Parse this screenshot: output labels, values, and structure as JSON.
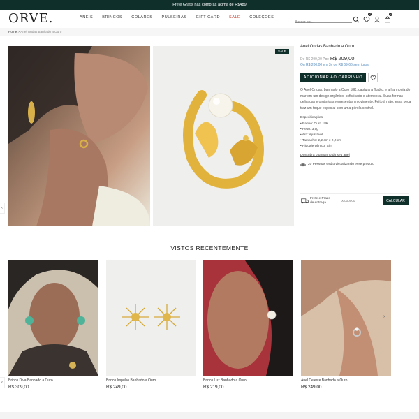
{
  "topbar": {
    "text": "Frete Grátis nas compras acima de R$489"
  },
  "header": {
    "logo": "ORVE.",
    "nav": [
      {
        "label": "ANÉIS",
        "sale": false
      },
      {
        "label": "BRINCOS",
        "sale": false
      },
      {
        "label": "COLARES",
        "sale": false
      },
      {
        "label": "PULSEIRAS",
        "sale": false
      },
      {
        "label": "GIFT CARD",
        "sale": false
      },
      {
        "label": "SALE",
        "sale": true
      },
      {
        "label": "COLEÇÕES",
        "sale": false
      }
    ],
    "search_placeholder": "Buscar por...",
    "wishlist_count": "0",
    "cart_count": "0"
  },
  "breadcrumb": {
    "home": "Home",
    "separator": ">",
    "current": "Anel Ondas Banhado a Ouro"
  },
  "gallery": {
    "sale_badge": "SALE"
  },
  "product": {
    "title": "Anel Ondas Banhado a Ouro",
    "old_price": "De R$ 299,00",
    "price_prefix": "Por:",
    "price": "R$ 209,00",
    "installments": "Ou R$ 200,00 em 3x de R$ 69,66 sem juros",
    "add_to_cart": "ADICIONAR AO CARRINHO",
    "description": "O Anel Ondas, banhado a Ouro 18K, captura a fluidez e a harmonia do mar em um design orgânico, sofisticado e atemporal. Suas formas delicadas e orgânicas representam movimento. Feito à mão, essa peça traz um toque especial com uma pérola central.",
    "specs_title": "Especificações:",
    "specs": [
      "• Banho: Ouro 18K",
      "• Peso: 3,5g",
      "• Aro: Ajustável",
      "• Tamanho: 2,2 cm x 2,2 cm",
      "• Hipoalergênico: Sim"
    ],
    "size_guide": "Descubra o tamanho do seu anel",
    "viewers": "20 Pessoas estão visualizando esse produto"
  },
  "shipping": {
    "label_line1": "Frete e Prazo",
    "label_line2": "de entrega",
    "cep_placeholder": "00000000",
    "calc_button": "CALCULAR"
  },
  "recent": {
    "title": "VISTOS RECENTEMENTE",
    "items": [
      {
        "name": "Brinco Diva Banhado a Ouro",
        "price": "R$ 309,00"
      },
      {
        "name": "Brinco Impulso Banhado a Ouro",
        "price": "R$ 249,00"
      },
      {
        "name": "Brinco Luz Banhado a Ouro",
        "price": "R$ 219,00"
      },
      {
        "name": "Anel Celeste Banhado a Ouro",
        "price": "R$ 249,00"
      }
    ]
  },
  "colors": {
    "brand_dark": "#0f2f2b",
    "sale_red": "#c0392b",
    "link_blue": "#5a8fbf"
  }
}
